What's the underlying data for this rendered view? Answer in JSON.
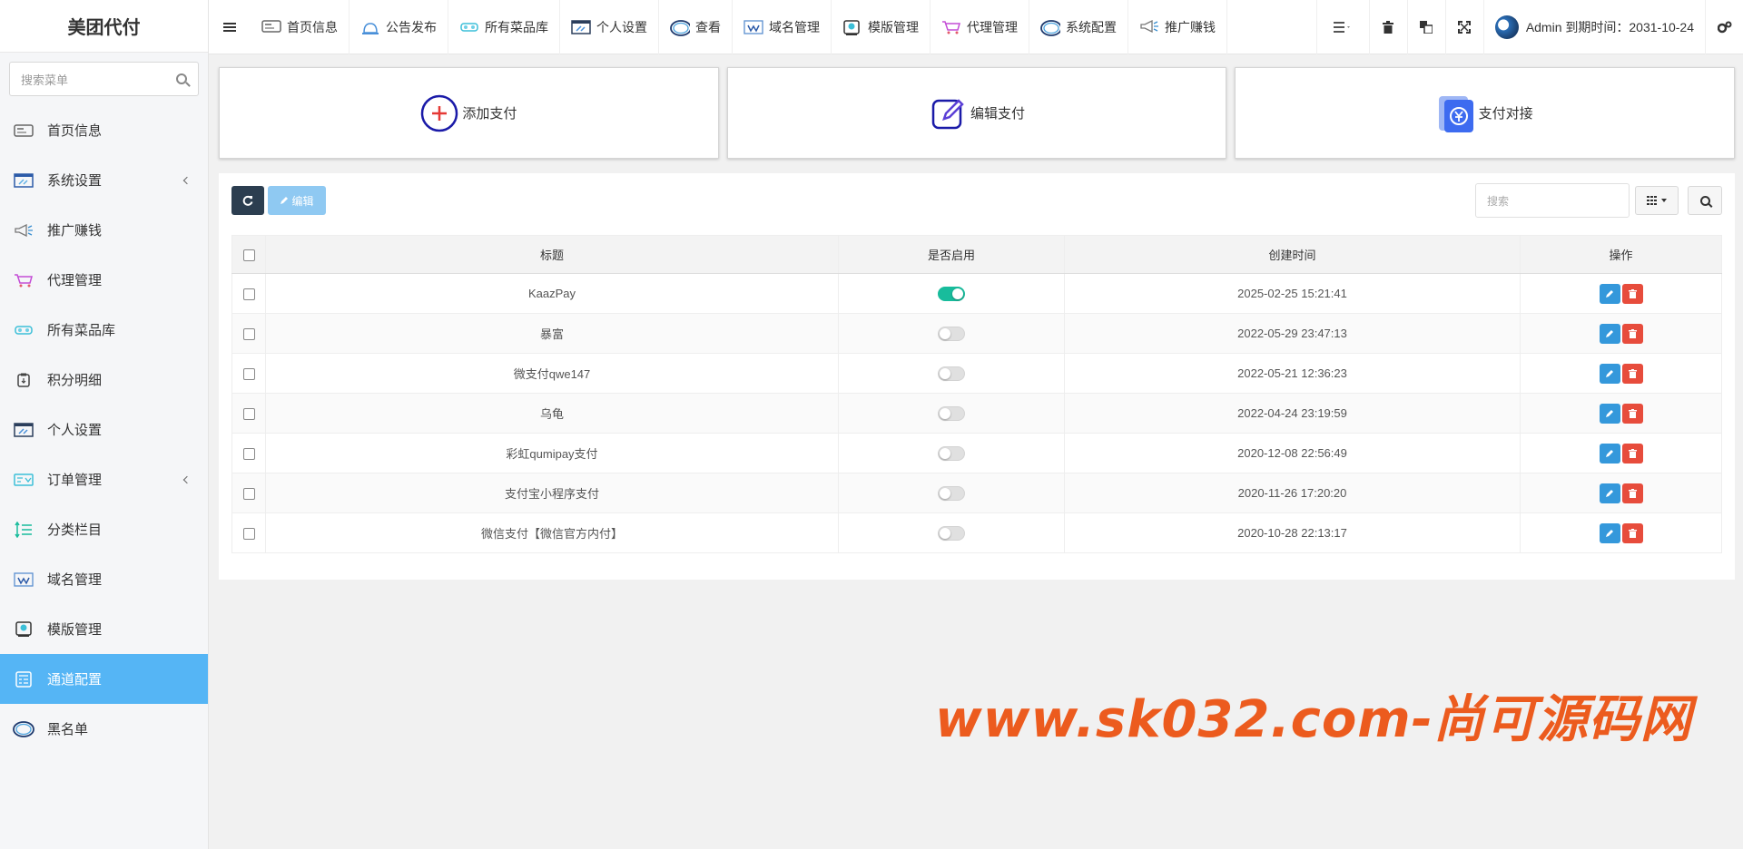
{
  "app": {
    "brand": "美团代付"
  },
  "sidebar": {
    "search_placeholder": "搜索菜单",
    "items": [
      {
        "label": "首页信息",
        "icon": "dashboard-icon",
        "has_sub": false,
        "active": false
      },
      {
        "label": "系统设置",
        "icon": "settings-window-icon",
        "has_sub": true,
        "active": false
      },
      {
        "label": "推广赚钱",
        "icon": "megaphone-icon",
        "has_sub": false,
        "active": false
      },
      {
        "label": "代理管理",
        "icon": "cart-icon",
        "has_sub": false,
        "active": false
      },
      {
        "label": "所有菜品库",
        "icon": "dishes-icon",
        "has_sub": false,
        "active": false
      },
      {
        "label": "积分明细",
        "icon": "clipboard-icon",
        "has_sub": false,
        "active": false
      },
      {
        "label": "个人设置",
        "icon": "window-tools-icon",
        "has_sub": false,
        "active": false
      },
      {
        "label": "订单管理",
        "icon": "orders-icon",
        "has_sub": true,
        "active": false
      },
      {
        "label": "分类栏目",
        "icon": "sort-lines-icon",
        "has_sub": false,
        "active": false
      },
      {
        "label": "域名管理",
        "icon": "domain-icon",
        "has_sub": false,
        "active": false
      },
      {
        "label": "模版管理",
        "icon": "template-icon",
        "has_sub": false,
        "active": false
      },
      {
        "label": "通道配置",
        "icon": "channel-icon",
        "has_sub": false,
        "active": true
      },
      {
        "label": "黑名单",
        "icon": "ring-icon",
        "has_sub": false,
        "active": false
      }
    ]
  },
  "topnav": {
    "items": [
      {
        "label": "首页信息",
        "icon": "dashboard-icon"
      },
      {
        "label": "公告发布",
        "icon": "bell-icon"
      },
      {
        "label": "所有菜品库",
        "icon": "dishes-icon"
      },
      {
        "label": "个人设置",
        "icon": "window-tools-icon"
      },
      {
        "label": "查看",
        "icon": "ring-icon"
      },
      {
        "label": "域名管理",
        "icon": "domain-icon"
      },
      {
        "label": "模版管理",
        "icon": "template-icon"
      },
      {
        "label": "代理管理",
        "icon": "cart-icon"
      },
      {
        "label": "系统配置",
        "icon": "ring-icon"
      },
      {
        "label": "推广赚钱",
        "icon": "megaphone-icon"
      }
    ],
    "user_text": "Admin 到期时间：2031-10-24"
  },
  "cards": [
    {
      "label": "添加支付",
      "icon": "add-circle-icon"
    },
    {
      "label": "编辑支付",
      "icon": "edit-square-icon"
    },
    {
      "label": "支付对接",
      "icon": "payment-yen-icon"
    }
  ],
  "toolbar": {
    "edit_label": "编辑",
    "search_placeholder": "搜索"
  },
  "table": {
    "headers": [
      "标题",
      "是否启用",
      "创建时间",
      "操作"
    ],
    "rows": [
      {
        "title": "KaazPay",
        "enabled": true,
        "created": "2025-02-25 15:21:41"
      },
      {
        "title": "暴富",
        "enabled": false,
        "created": "2022-05-29 23:47:13"
      },
      {
        "title": "微支付qwe147",
        "enabled": false,
        "created": "2022-05-21 12:36:23"
      },
      {
        "title": "乌龟",
        "enabled": false,
        "created": "2022-04-24 23:19:59"
      },
      {
        "title": "彩虹qumipay支付",
        "enabled": false,
        "created": "2020-12-08 22:56:49"
      },
      {
        "title": "支付宝小程序支付",
        "enabled": false,
        "created": "2020-11-26 17:20:20"
      },
      {
        "title": "微信支付【微信官方内付】",
        "enabled": false,
        "created": "2020-10-28 22:13:17"
      }
    ]
  },
  "watermark": "www.sk032.com-尚可源码网",
  "colors": {
    "active_menu": "#55b5f5",
    "switch_on": "#18bc9c",
    "edit_button": "#3498db",
    "delete_button": "#e74c3c",
    "refresh_button": "#2c3e50",
    "watermark": "#ec5b1e"
  }
}
